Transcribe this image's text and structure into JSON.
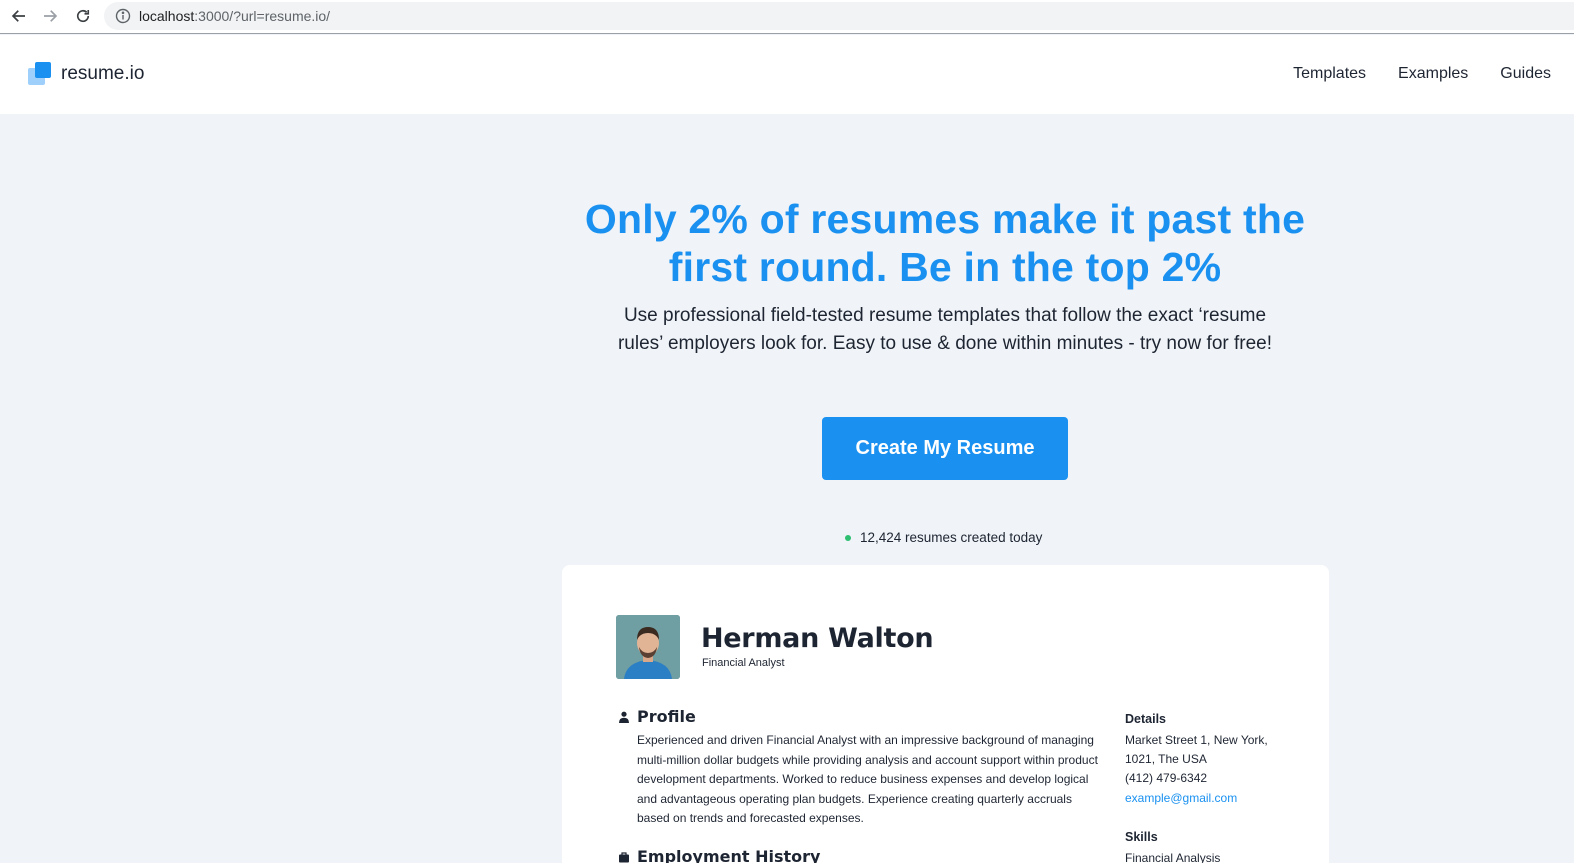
{
  "browser": {
    "url_host": "localhost",
    "url_rest": ":3000/?url=resume.io/"
  },
  "header": {
    "logo_text": "resume.io",
    "nav": [
      "Templates",
      "Examples",
      "Guides"
    ]
  },
  "hero": {
    "title": "Only 2% of resumes make it past the first round. Be in the top 2%",
    "subtitle": "Use professional field-tested resume templates that follow the exact ‘resume rules’ employers look for. Easy to use & done within minutes - try now for free!",
    "cta_label": "Create My Resume",
    "counter_text": "12,424 resumes created today"
  },
  "resume": {
    "name": "Herman Walton",
    "role": "Financial Analyst",
    "profile_title": "Profile",
    "profile_text": "Experienced and driven Financial Analyst with an impressive background of managing multi-million dollar budgets while providing analysis and account support within product development departments. Worked to reduce business expenses and develop logical and advantageous operating plan budgets. Experience creating quarterly accruals based on trends and forecasted expenses.",
    "employment_title": "Employment History",
    "details_title": "Details",
    "details_address_1": "Market Street 1, New York,",
    "details_address_2": "1021, The USA",
    "details_phone": "(412) 479-6342",
    "details_email": "example@gmail.com",
    "skills_title": "Skills",
    "skills_first": "Financial Analysis"
  },
  "colors": {
    "accent": "#1a91f0",
    "page_bg": "#f0f4f8",
    "status_dot": "#2fbf71"
  }
}
